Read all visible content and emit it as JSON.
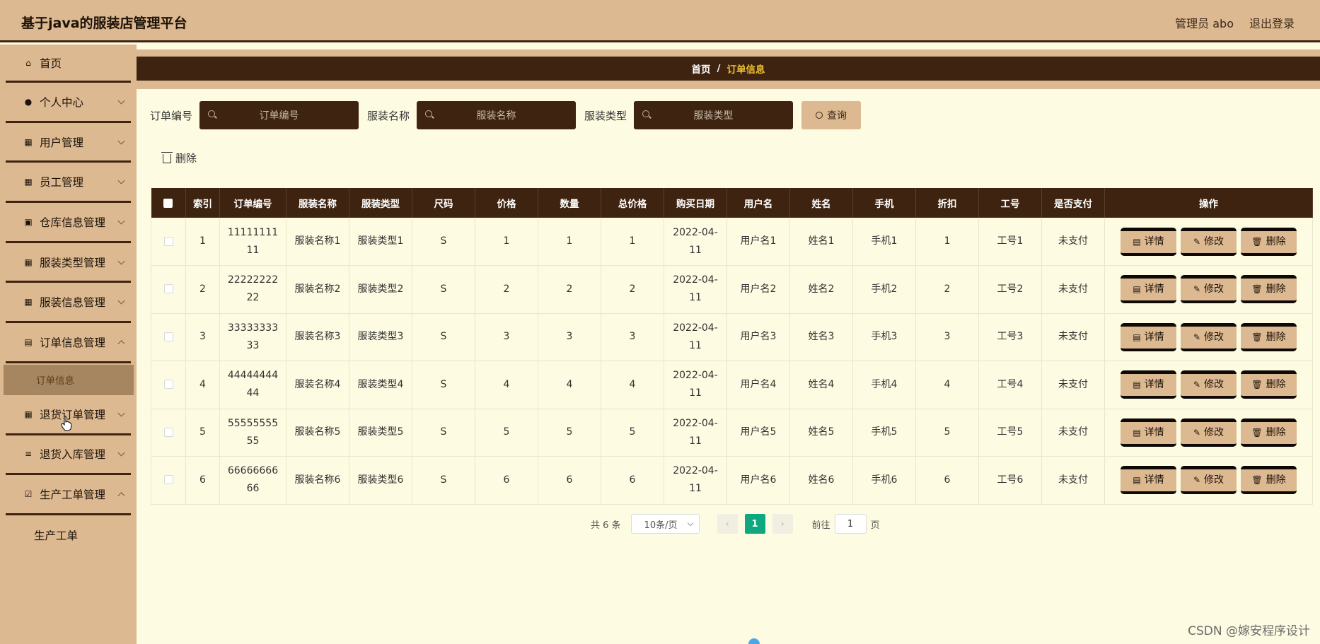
{
  "header": {
    "title": "基于java的服装店管理平台",
    "user": "管理员 abo",
    "logout": "退出登录"
  },
  "sidebar": {
    "items": [
      {
        "label": "首页",
        "icon": "home-icon"
      },
      {
        "label": "个人中心",
        "icon": "user-icon"
      },
      {
        "label": "用户管理",
        "icon": "grid-icon"
      },
      {
        "label": "员工管理",
        "icon": "grid-icon"
      },
      {
        "label": "仓库信息管理",
        "icon": "lock-icon"
      },
      {
        "label": "服装类型管理",
        "icon": "grid-icon"
      },
      {
        "label": "服装信息管理",
        "icon": "grid-icon"
      },
      {
        "label": "订单信息管理",
        "icon": "clipboard-icon"
      }
    ],
    "active_sub": "订单信息",
    "items2": [
      {
        "label": "退货订单管理",
        "icon": "grid-icon"
      },
      {
        "label": "退货入库管理",
        "icon": "sliders-icon"
      },
      {
        "label": "生产工单管理",
        "icon": "check-square-icon"
      }
    ],
    "last_sub": "生产工单"
  },
  "breadcrumb": {
    "home": "首页",
    "sep": "/",
    "current": "订单信息"
  },
  "search": {
    "order_no_label": "订单编号",
    "order_no_placeholder": "订单编号",
    "cloth_name_label": "服装名称",
    "cloth_name_placeholder": "服装名称",
    "cloth_type_label": "服装类型",
    "cloth_type_placeholder": "服装类型",
    "query": "查询"
  },
  "toolbar": {
    "delete": "删除"
  },
  "table": {
    "columns": [
      "索引",
      "订单编号",
      "服装名称",
      "服装类型",
      "尺码",
      "价格",
      "数量",
      "总价格",
      "购买日期",
      "用户名",
      "姓名",
      "手机",
      "折扣",
      "工号",
      "是否支付",
      "操作"
    ],
    "rows": [
      [
        "1",
        "1111111111",
        "服装名称1",
        "服装类型1",
        "S",
        "1",
        "1",
        "1",
        "2022-04-11",
        "用户名1",
        "姓名1",
        "手机1",
        "1",
        "工号1",
        "未支付"
      ],
      [
        "2",
        "2222222222",
        "服装名称2",
        "服装类型2",
        "S",
        "2",
        "2",
        "2",
        "2022-04-11",
        "用户名2",
        "姓名2",
        "手机2",
        "2",
        "工号2",
        "未支付"
      ],
      [
        "3",
        "3333333333",
        "服装名称3",
        "服装类型3",
        "S",
        "3",
        "3",
        "3",
        "2022-04-11",
        "用户名3",
        "姓名3",
        "手机3",
        "3",
        "工号3",
        "未支付"
      ],
      [
        "4",
        "4444444444",
        "服装名称4",
        "服装类型4",
        "S",
        "4",
        "4",
        "4",
        "2022-04-11",
        "用户名4",
        "姓名4",
        "手机4",
        "4",
        "工号4",
        "未支付"
      ],
      [
        "5",
        "5555555555",
        "服装名称5",
        "服装类型5",
        "S",
        "5",
        "5",
        "5",
        "2022-04-11",
        "用户名5",
        "姓名5",
        "手机5",
        "5",
        "工号5",
        "未支付"
      ],
      [
        "6",
        "6666666666",
        "服装名称6",
        "服装类型6",
        "S",
        "6",
        "6",
        "6",
        "2022-04-11",
        "用户名6",
        "姓名6",
        "手机6",
        "6",
        "工号6",
        "未支付"
      ]
    ],
    "actions": {
      "detail": "详情",
      "edit": "修改",
      "delete": "删除"
    }
  },
  "pagination": {
    "total": "共 6 条",
    "page_size": "10条/页",
    "current_page": "1",
    "goto_label": "前往",
    "goto_value": "1",
    "page_unit": "页"
  },
  "watermark": "CSDN @嫁安程序设计",
  "colors": {
    "accent": "#dcb990",
    "dark": "#3e2410",
    "background": "#fdfbe1",
    "active_page": "#0ea77f"
  }
}
